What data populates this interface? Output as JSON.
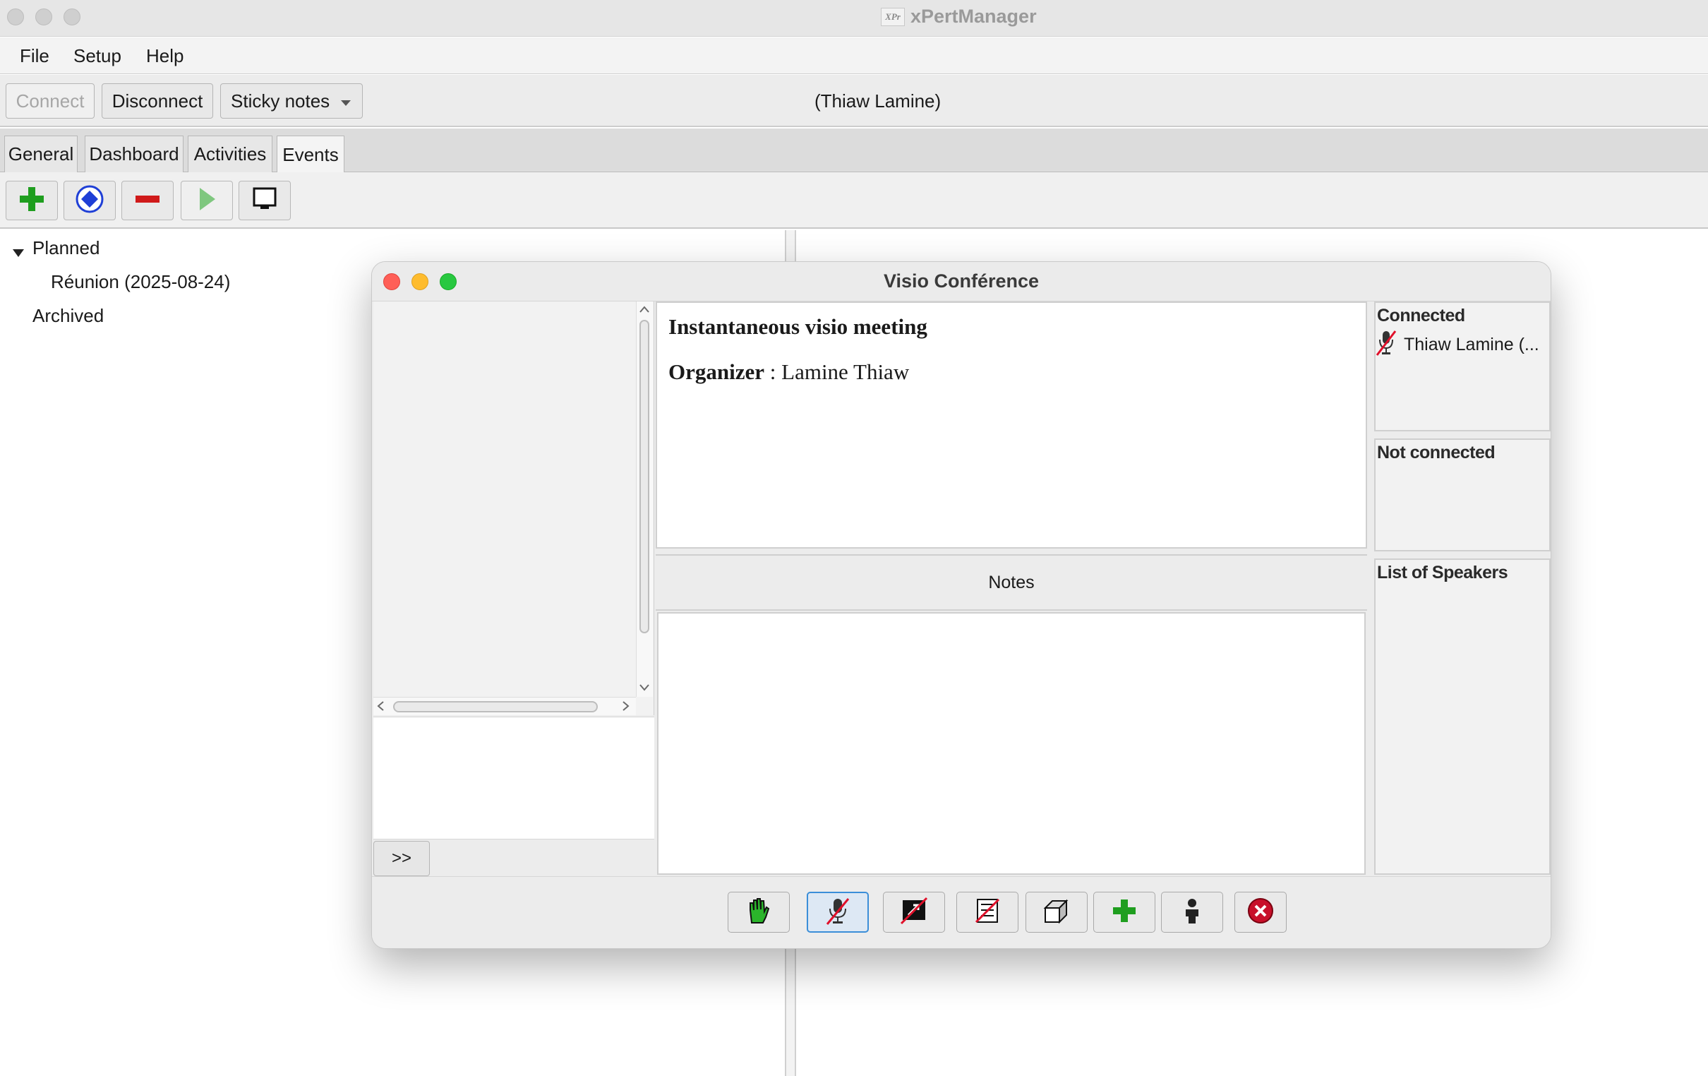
{
  "window": {
    "title": "xPertManager",
    "logo_text": "XPr"
  },
  "menu": {
    "file": "File",
    "setup": "Setup",
    "help": "Help"
  },
  "toolbar": {
    "connect_label": "Connect",
    "disconnect_label": "Disconnect",
    "sticky_notes_label": "Sticky notes",
    "current_user": "(Thiaw Lamine)"
  },
  "tabs": {
    "general": "General",
    "dashboard": "Dashboard",
    "activities": "Activities",
    "events": "Events",
    "active": "Events"
  },
  "tree": {
    "planned": "Planned",
    "meeting": "Réunion (2025-08-24)",
    "archived": "Archived"
  },
  "dialog": {
    "title": "Visio Conférence",
    "meeting_title": "Instantaneous visio meeting",
    "organizer_label": "Organizer",
    "organizer_separator": " : ",
    "organizer_name": "Lamine Thiaw",
    "notes_label": "Notes",
    "expand_label": ">>",
    "connected_label": "Connected",
    "participant": "Thiaw Lamine (...",
    "not_connected_label": "Not connected",
    "speakers_label": "List of Speakers"
  },
  "icons": {
    "add": "plus-icon",
    "record": "record-icon",
    "remove": "minus-icon",
    "play": "play-icon",
    "monitor": "monitor-icon",
    "raise_hand": "raised-hand-icon",
    "mic_muted": "microphone-muted-icon",
    "screen_share_off": "screen-share-off-icon",
    "whiteboard_off": "whiteboard-off-icon",
    "box": "box-icon",
    "invite": "plus-icon",
    "person": "person-icon",
    "leave": "close-circle-icon"
  },
  "colors": {
    "accent_green": "#1f9e1f",
    "accent_blue": "#1f3fd6",
    "accent_red": "#d01a1a",
    "selection_blue": "#3b8ed8"
  }
}
